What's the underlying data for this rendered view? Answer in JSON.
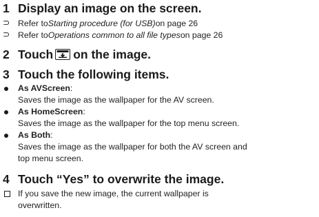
{
  "steps": [
    {
      "num": "1",
      "text": "Display an image on the screen."
    },
    {
      "num": "2",
      "text_before_icon": "Touch",
      "text_after_icon": "on the image."
    },
    {
      "num": "3",
      "text": "Touch the following items."
    },
    {
      "num": "4",
      "text": "Touch “Yes” to overwrite the image."
    }
  ],
  "refs": [
    {
      "prefix": "Refer to ",
      "link": "Starting procedure (for USB)",
      "suffix": " on page 26"
    },
    {
      "prefix": "Refer to ",
      "link": "Operations common to all file types",
      "suffix": " on page 26"
    }
  ],
  "items": [
    {
      "label": "As AVScreen",
      "colon": ":",
      "desc": "Saves the image as the wallpaper for the AV screen."
    },
    {
      "label": "As HomeScreen",
      "colon": ":",
      "desc": "Saves the image as the wallpaper for the top menu screen."
    },
    {
      "label": "As Both",
      "colon": ":",
      "desc_line1": "Saves the image as the wallpaper for both the AV screen and",
      "desc_line2": "top menu screen."
    }
  ],
  "note": {
    "line1": "If you save the new image, the current wallpaper is",
    "line2": "overwritten."
  },
  "icons": {
    "ref_marker": "arrow-marker-icon",
    "bullet": "bullet-icon",
    "note_marker": "checkbox-icon",
    "save": "save-image-icon"
  },
  "colors": {
    "text": "#1a1a1a"
  }
}
